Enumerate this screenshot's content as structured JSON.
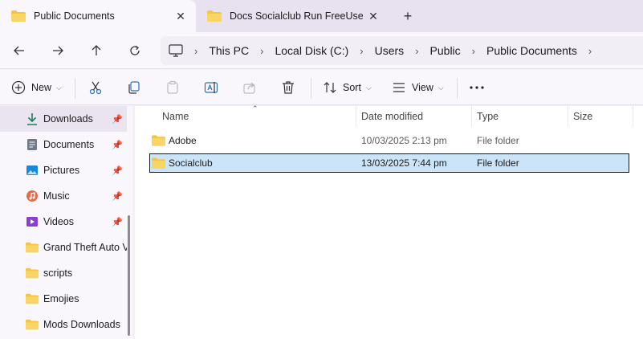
{
  "tabs": [
    {
      "title": "Public Documents",
      "active": true
    },
    {
      "title": "Docs Socialclub Run FreeUsers",
      "active": false
    }
  ],
  "address": {
    "crumbs": [
      "This PC",
      "Local Disk (C:)",
      "Users",
      "Public",
      "Public Documents"
    ]
  },
  "toolbar": {
    "new_label": "New",
    "sort_label": "Sort",
    "view_label": "View"
  },
  "sidebar": {
    "items": [
      {
        "label": "Downloads",
        "icon": "download-icon",
        "pinned": true
      },
      {
        "label": "Documents",
        "icon": "document-icon",
        "pinned": true
      },
      {
        "label": "Pictures",
        "icon": "pictures-icon",
        "pinned": true
      },
      {
        "label": "Music",
        "icon": "music-icon",
        "pinned": true
      },
      {
        "label": "Videos",
        "icon": "videos-icon",
        "pinned": true
      },
      {
        "label": "Grand Theft Auto V",
        "icon": "folder-icon",
        "pinned": false
      },
      {
        "label": "scripts",
        "icon": "folder-icon",
        "pinned": false
      },
      {
        "label": "Emojies",
        "icon": "folder-icon",
        "pinned": false
      },
      {
        "label": "Mods Downloads",
        "icon": "folder-icon",
        "pinned": false
      }
    ]
  },
  "columns": [
    "Name",
    "Date modified",
    "Type",
    "Size"
  ],
  "files": [
    {
      "name": "Adobe",
      "date": "10/03/2025 2:13 pm",
      "type": "File folder",
      "size": ""
    },
    {
      "name": "Socialclub",
      "date": "13/03/2025 7:44 pm",
      "type": "File folder",
      "size": ""
    }
  ],
  "colors": {
    "folder": "#f4c542",
    "selection": "#cce4f7",
    "accent": "#1a7f5a"
  }
}
